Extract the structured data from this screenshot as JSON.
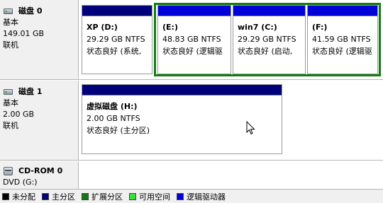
{
  "disks": [
    {
      "title": "磁盘 0",
      "type": "基本",
      "size": "149.01 GB",
      "status": "联机",
      "partitions": [
        {
          "name": "XP  (D:)",
          "size": "29.29 GB NTFS",
          "status": "状态良好 (系统, ",
          "kind": "primary"
        },
        {
          "name": "(E:)",
          "size": "48.83 GB NTFS",
          "status": "状态良好 (逻辑驱",
          "kind": "logical"
        },
        {
          "name": "win7  (C:)",
          "size": "29.29 GB NTFS",
          "status": "状态良好 (启动, ",
          "kind": "logical"
        },
        {
          "name": "(F:)",
          "size": "41.59 GB NTFS",
          "status": "状态良好 (逻辑驱",
          "kind": "logical"
        }
      ]
    },
    {
      "title": "磁盘 1",
      "type": "基本",
      "size": "2.00 GB",
      "status": "联机",
      "partitions": [
        {
          "name": "虚拟磁盘  (H:)",
          "size": "2.00 GB NTFS",
          "status": "状态良好 (主分区)",
          "kind": "primary"
        }
      ]
    },
    {
      "title": "CD-ROM 0",
      "type": "DVD (G:)"
    }
  ],
  "legend": [
    {
      "label": "未分配",
      "color": "#000000"
    },
    {
      "label": "主分区",
      "color": "#00007b"
    },
    {
      "label": "扩展分区",
      "color": "#0f7d0f"
    },
    {
      "label": "可用空间",
      "color": "#3ddc3d"
    },
    {
      "label": "逻辑驱动器",
      "color": "#0000d8"
    }
  ],
  "colors": {
    "primary": "#00007b",
    "logical": "#0000d8",
    "extended": "#0f7d0f"
  }
}
